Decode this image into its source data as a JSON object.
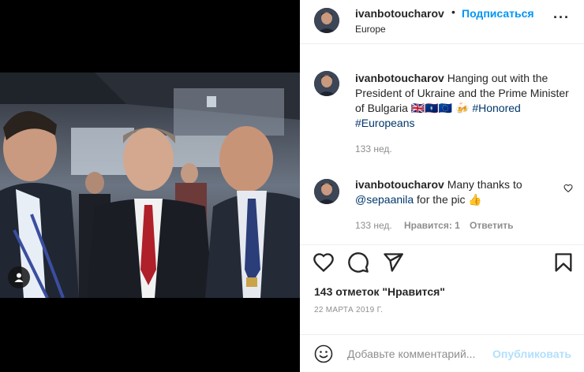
{
  "post": {
    "username": "ivanbotoucharov",
    "follow_separator": "•",
    "follow_label": "Подписаться",
    "location": "Europe",
    "more_label": "···"
  },
  "caption": {
    "username": "ivanbotoucharov",
    "text": "Hanging out with the President of Ukraine and the Prime Minister of Bulgaria 🇬🇧🇬🇺🇪🇺 🍻",
    "hashtags": "#Honored #Europeans",
    "age": "133 нед."
  },
  "comment": {
    "username": "ivanbotoucharov",
    "text_before": "Many thanks to",
    "mention": "@sepaanila",
    "text_after": "for the pic 👍",
    "age": "133 нед.",
    "likes_label": "Нравится: 1",
    "reply_label": "Ответить"
  },
  "stats": {
    "likes_label": "143 отметок \"Нравится\"",
    "date": "22 МАРТА 2019 Г."
  },
  "composer": {
    "placeholder": "Добавьте комментарий...",
    "post_label": "Опубликовать"
  },
  "colors": {
    "link": "#0095f6",
    "post_disabled": "#b2dffc",
    "hashtag": "#00376b",
    "muted": "#8e8e8e",
    "text": "#262626"
  },
  "icons": [
    "user-tag-icon",
    "more-icon",
    "heart-icon",
    "comment-icon",
    "share-icon",
    "bookmark-icon",
    "emoji-icon"
  ]
}
